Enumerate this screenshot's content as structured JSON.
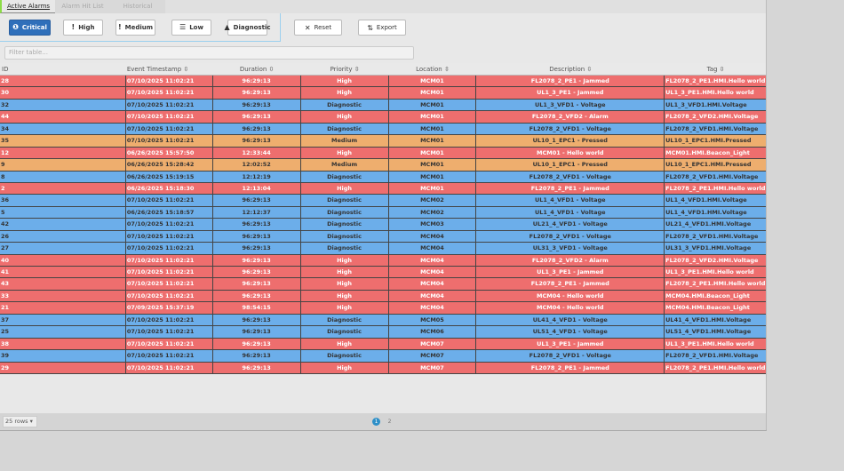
{
  "tabs": [
    "Active Alarms",
    "Alarm Hit List",
    "Historical"
  ],
  "toolbar": {
    "critical": "Critical",
    "high": "High",
    "medium": "Medium",
    "low": "Low",
    "diagnostic": "Diagnostic",
    "reset": "Reset",
    "export": "Export"
  },
  "filter": {
    "placeholder": "Filter table..."
  },
  "columns": [
    "ID",
    "Event Timestamp ⇳",
    "Duration ⇳",
    "Priority ⇳",
    "Location ⇳",
    "Description ⇳",
    "Tag ⇳"
  ],
  "colors": {
    "High": "#ee6e6e",
    "Diagnostic": "#6caeea",
    "Medium": "#eeae6e"
  },
  "rows": [
    [
      "28",
      "07/10/2025 11:02:21",
      "96:29:13",
      "High",
      "MCM01",
      "FL2078_2_PE1 - Jammed",
      "FL2078_2_PE1.HMI.Hello world"
    ],
    [
      "30",
      "07/10/2025 11:02:21",
      "96:29:13",
      "High",
      "MCM01",
      "UL1_3_PE1 - Jammed",
      "UL1_3_PE1.HMI.Hello world"
    ],
    [
      "32",
      "07/10/2025 11:02:21",
      "96:29:13",
      "Diagnostic",
      "MCM01",
      "UL1_3_VFD1 - Voltage",
      "UL1_3_VFD1.HMI.Voltage"
    ],
    [
      "44",
      "07/10/2025 11:02:21",
      "96:29:13",
      "High",
      "MCM01",
      "FL2078_2_VFD2 - Alarm",
      "FL2078_2_VFD2.HMI.Voltage"
    ],
    [
      "34",
      "07/10/2025 11:02:21",
      "96:29:13",
      "Diagnostic",
      "MCM01",
      "FL2078_2_VFD1 - Voltage",
      "FL2078_2_VFD1.HMI.Voltage"
    ],
    [
      "35",
      "07/10/2025 11:02:21",
      "96:29:13",
      "Medium",
      "MCM01",
      "UL10_1_EPC1 - Pressed",
      "UL10_1_EPC1.HMI.Pressed"
    ],
    [
      "12",
      "06/26/2025 15:57:50",
      "12:33:44",
      "High",
      "MCM01",
      "MCM01 - Hello world",
      "MCM01.HMI.Beacon_Light"
    ],
    [
      "9",
      "06/26/2025 15:28:42",
      "12:02:52",
      "Medium",
      "MCM01",
      "UL10_1_EPC1 - Pressed",
      "UL10_1_EPC1.HMI.Pressed"
    ],
    [
      "8",
      "06/26/2025 15:19:15",
      "12:12:19",
      "Diagnostic",
      "MCM01",
      "FL2078_2_VFD1 - Voltage",
      "FL2078_2_VFD1.HMI.Voltage"
    ],
    [
      "2",
      "06/26/2025 15:18:30",
      "12:13:04",
      "High",
      "MCM01",
      "FL2078_2_PE1 - Jammed",
      "FL2078_2_PE1.HMI.Hello world"
    ],
    [
      "36",
      "07/10/2025 11:02:21",
      "96:29:13",
      "Diagnostic",
      "MCM02",
      "UL1_4_VFD1 - Voltage",
      "UL1_4_VFD1.HMI.Voltage"
    ],
    [
      "5",
      "06/26/2025 15:18:57",
      "12:12:37",
      "Diagnostic",
      "MCM02",
      "UL1_4_VFD1 - Voltage",
      "UL1_4_VFD1.HMI.Voltage"
    ],
    [
      "42",
      "07/10/2025 11:02:21",
      "96:29:13",
      "Diagnostic",
      "MCM03",
      "UL21_4_VFD1 - Voltage",
      "UL21_4_VFD1.HMI.Voltage"
    ],
    [
      "26",
      "07/10/2025 11:02:21",
      "96:29:13",
      "Diagnostic",
      "MCM04",
      "FL2078_2_VFD1 - Voltage",
      "FL2078_2_VFD1.HMI.Voltage"
    ],
    [
      "27",
      "07/10/2025 11:02:21",
      "96:29:13",
      "Diagnostic",
      "MCM04",
      "UL31_3_VFD1 - Voltage",
      "UL31_3_VFD1.HMI.Voltage"
    ],
    [
      "40",
      "07/10/2025 11:02:21",
      "96:29:13",
      "High",
      "MCM04",
      "FL2078_2_VFD2 - Alarm",
      "FL2078_2_VFD2.HMI.Voltage"
    ],
    [
      "41",
      "07/10/2025 11:02:21",
      "96:29:13",
      "High",
      "MCM04",
      "UL1_3_PE1 - Jammed",
      "UL1_3_PE1.HMI.Hello world"
    ],
    [
      "43",
      "07/10/2025 11:02:21",
      "96:29:13",
      "High",
      "MCM04",
      "FL2078_2_PE1 - Jammed",
      "FL2078_2_PE1.HMI.Hello world"
    ],
    [
      "33",
      "07/10/2025 11:02:21",
      "96:29:13",
      "High",
      "MCM04",
      "MCM04 - Hello world",
      "MCM04.HMI.Beacon_Light"
    ],
    [
      "21",
      "07/09/2025 15:37:19",
      "98:54:15",
      "High",
      "MCM04",
      "MCM04 - Hello world",
      "MCM04.HMI.Beacon_Light"
    ],
    [
      "37",
      "07/10/2025 11:02:21",
      "96:29:13",
      "Diagnostic",
      "MCM05",
      "UL41_4_VFD1 - Voltage",
      "UL41_4_VFD1.HMI.Voltage"
    ],
    [
      "25",
      "07/10/2025 11:02:21",
      "96:29:13",
      "Diagnostic",
      "MCM06",
      "UL51_4_VFD1 - Voltage",
      "UL51_4_VFD1.HMI.Voltage"
    ],
    [
      "38",
      "07/10/2025 11:02:21",
      "96:29:13",
      "High",
      "MCM07",
      "UL1_3_PE1 - Jammed",
      "UL1_3_PE1.HMI.Hello world"
    ],
    [
      "39",
      "07/10/2025 11:02:21",
      "96:29:13",
      "Diagnostic",
      "MCM07",
      "FL2078_2_VFD1 - Voltage",
      "FL2078_2_VFD1.HMI.Voltage"
    ],
    [
      "29",
      "07/10/2025 11:02:21",
      "96:29:13",
      "High",
      "MCM07",
      "FL2078_2_PE1 - Jammed",
      "FL2078_2_PE1.HMI.Hello world"
    ]
  ],
  "footer": {
    "rows_per_page": "25 rows ▾",
    "pages": [
      "1",
      "2"
    ],
    "current_page": "1"
  }
}
